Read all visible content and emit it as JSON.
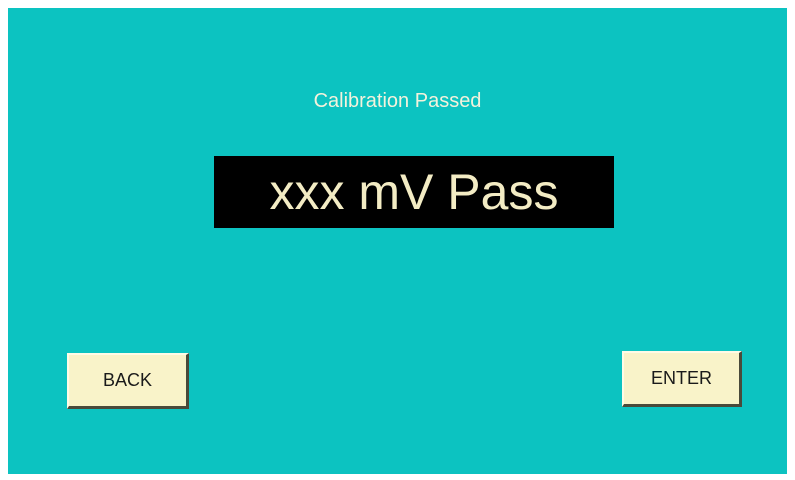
{
  "screen": {
    "title": "Calibration Passed",
    "readout": "xxx mV Pass"
  },
  "buttons": {
    "back_label": "BACK",
    "enter_label": "ENTER"
  },
  "colors": {
    "background": "#0cc3c1",
    "readout_bg": "#000000",
    "readout_text": "#f3ecc4",
    "button_bg": "#f9f3c9"
  }
}
